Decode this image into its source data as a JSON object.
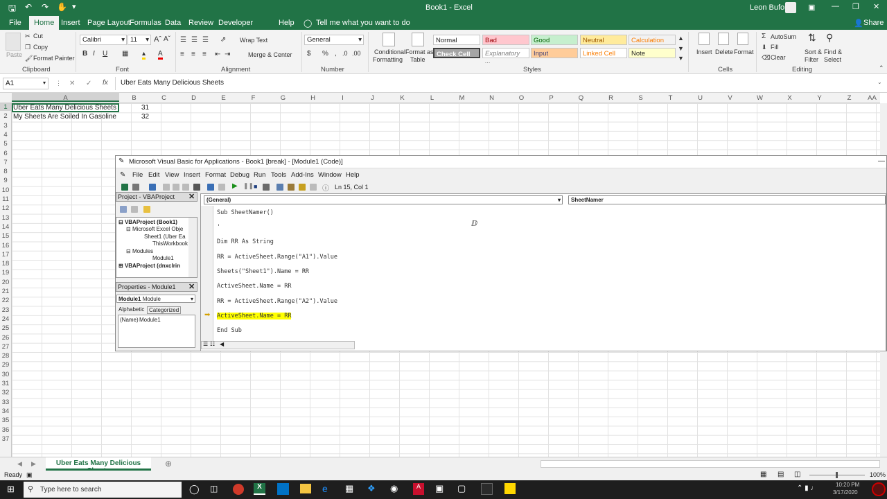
{
  "titlebar": {
    "doc": "Book1  -  Excel",
    "user": "Leon Buford"
  },
  "menu": {
    "tabs": [
      "File",
      "Home",
      "Insert",
      "Page Layout",
      "Formulas",
      "Data",
      "Review",
      "Developer",
      "Help"
    ],
    "tell_me": "Tell me what you want to do",
    "share": "Share"
  },
  "ribbon": {
    "clipboard": {
      "paste": "Paste",
      "cut": "Cut",
      "copy": "Copy",
      "format_painter": "Format Painter",
      "label": "Clipboard"
    },
    "font": {
      "name": "Calibri",
      "size": "11",
      "label": "Font"
    },
    "alignment": {
      "wrap": "Wrap Text",
      "merge": "Merge & Center",
      "label": "Alignment"
    },
    "number": {
      "format": "General",
      "label": "Number"
    },
    "styles": {
      "cond": "Conditional",
      "cond2": "Formatting",
      "fmt_table": "Format as",
      "fmt_table2": "Table",
      "normal": "Normal",
      "bad": "Bad",
      "good": "Good",
      "neutral": "Neutral",
      "calculation": "Calculation",
      "check": "Check Cell",
      "explanatory": "Explanatory ...",
      "input": "Input",
      "linked": "Linked Cell",
      "note": "Note",
      "label": "Styles"
    },
    "cells": {
      "insert": "Insert",
      "delete": "Delete",
      "format": "Format",
      "label": "Cells"
    },
    "editing": {
      "autosum": "AutoSum",
      "fill": "Fill",
      "clear": "Clear",
      "sort": "Sort &",
      "sort2": "Filter",
      "find": "Find &",
      "find2": "Select",
      "label": "Editing"
    }
  },
  "formula_bar": {
    "name_box": "A1",
    "fx": "fx",
    "content": "Uber Eats Many Delicious Sheets"
  },
  "columns": [
    "A",
    "B",
    "C",
    "D",
    "E",
    "F",
    "G",
    "H",
    "I",
    "J",
    "K",
    "L",
    "M",
    "N",
    "O",
    "P",
    "Q",
    "R",
    "S",
    "T",
    "U",
    "V",
    "W",
    "X",
    "Y",
    "Z",
    "AA"
  ],
  "rows": [
    "1",
    "2",
    "3",
    "4",
    "5",
    "6",
    "7",
    "8",
    "9",
    "10",
    "11",
    "12",
    "13",
    "14",
    "15",
    "16",
    "17",
    "18",
    "19",
    "20",
    "21",
    "22",
    "23",
    "24",
    "25",
    "26",
    "27",
    "28",
    "29",
    "30",
    "31",
    "32",
    "33",
    "34",
    "35",
    "36",
    "37"
  ],
  "cells": {
    "a1": "Uber Eats Many Delicious Sheets",
    "b1": "31",
    "a2": "My Sheets Are Soiled In Gasoline",
    "b2": "32"
  },
  "sheet_tab": "Uber Eats Many Delicious Sheets",
  "status": {
    "ready": "Ready",
    "zoom": "100%"
  },
  "taskbar": {
    "search": "Type here to search",
    "time": "10:20 PM",
    "date": "3/17/2020"
  },
  "vba": {
    "title": "Microsoft Visual Basic for Applications - Book1 [break] - [Module1 (Code)]",
    "menu": [
      "File",
      "Edit",
      "View",
      "Insert",
      "Format",
      "Debug",
      "Run",
      "Tools",
      "Add-Ins",
      "Window",
      "Help"
    ],
    "position": "Ln 15, Col 1",
    "project_title": "Project - VBAProject",
    "tree": [
      "VBAProject (Book1)",
      "Microsoft Excel Obje",
      "Sheet1 (Uber Ea",
      "ThisWorkbook",
      "Modules",
      "Module1",
      "VBAProject (dnxclrin"
    ],
    "props_title": "Properties - Module1",
    "props_object": "Module1",
    "props_type": "Module",
    "props_tabs": [
      "Alphabetic",
      "Categorized"
    ],
    "props_name_key": "(Name)",
    "props_name_val": "Module1",
    "general": "(General)",
    "proc": "SheetNamer",
    "code": [
      "Sub SheetNamer()",
      "'",
      "Dim RR As String",
      "RR = ActiveSheet.Range(\"A1\").Value",
      "Sheets(\"Sheet1\").Name = RR",
      "ActiveSheet.Name = RR",
      "RR = ActiveSheet.Range(\"A2\").Value",
      "ActiveSheet.Name = RR",
      "End Sub"
    ],
    "highlight_color": "#ffff00"
  }
}
